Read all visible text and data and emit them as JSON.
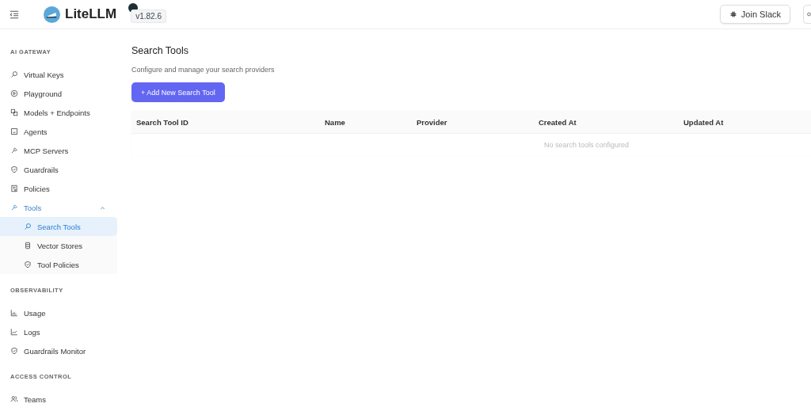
{
  "header": {
    "brand": "LiteLLM",
    "version": "v1.82.6",
    "buttons": [
      "Join Slack"
    ]
  },
  "sidebar": {
    "sections": [
      {
        "heading": "AI GATEWAY",
        "items": [
          {
            "label": "Virtual Keys",
            "selected": false
          },
          {
            "label": "Playground",
            "selected": false
          },
          {
            "label": "Models + Endpoints",
            "selected": false
          },
          {
            "label": "Agents",
            "selected": false
          },
          {
            "label": "MCP Servers",
            "selected": false
          },
          {
            "label": "Guardrails",
            "selected": false
          },
          {
            "label": "Policies",
            "selected": false
          },
          {
            "label": "Tools",
            "selected": false,
            "expanded": true,
            "children": [
              {
                "label": "Search Tools",
                "selected": true
              },
              {
                "label": "Vector Stores",
                "selected": false
              },
              {
                "label": "Tool Policies",
                "selected": false
              }
            ]
          }
        ]
      },
      {
        "heading": "OBSERVABILITY",
        "items": [
          {
            "label": "Usage",
            "selected": false
          },
          {
            "label": "Logs",
            "selected": false
          },
          {
            "label": "Guardrails Monitor",
            "selected": false
          }
        ]
      },
      {
        "heading": "ACCESS CONTROL",
        "items": [
          {
            "label": "Teams",
            "selected": false
          }
        ]
      }
    ]
  },
  "page": {
    "title": "Search Tools",
    "subtitle": "Configure and manage your search providers",
    "add_button": "+ Add New Search Tool",
    "table": {
      "columns": [
        "Search Tool ID",
        "Name",
        "Provider",
        "Created At",
        "Updated At"
      ],
      "empty_text": "No search tools configured"
    }
  }
}
